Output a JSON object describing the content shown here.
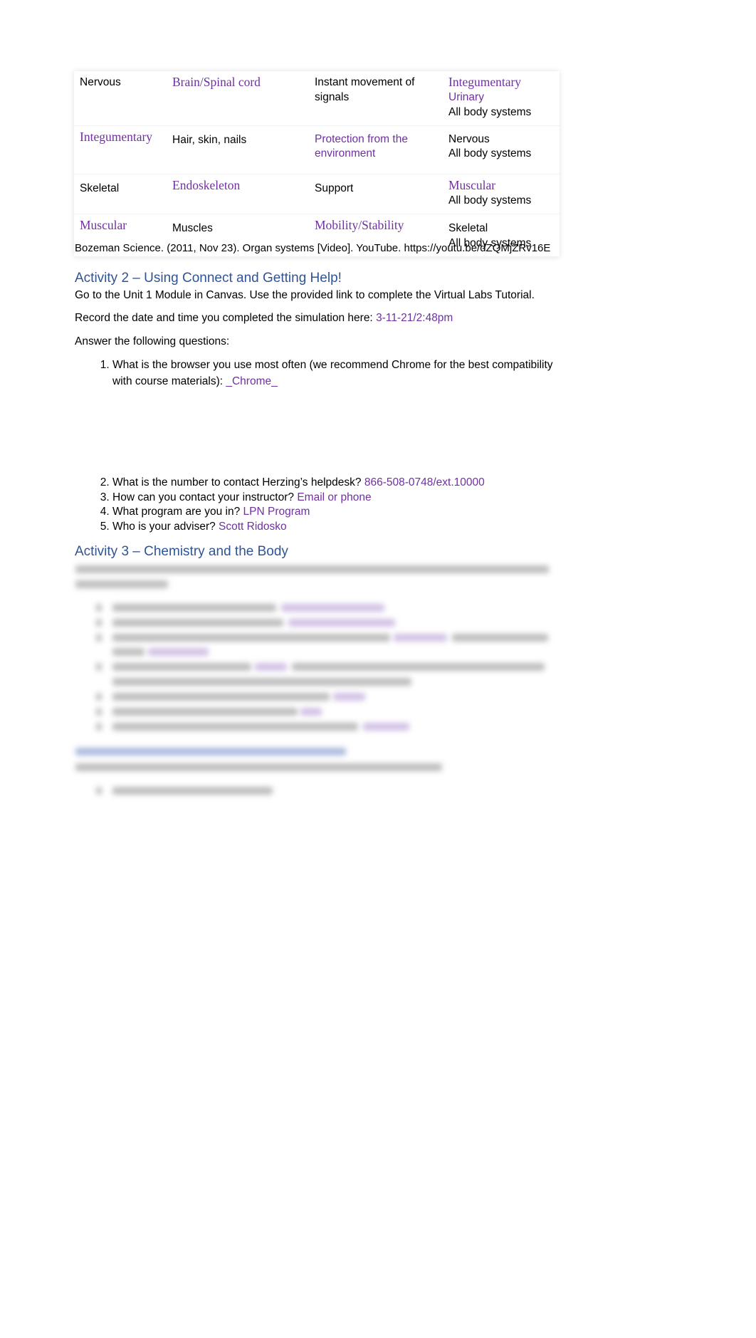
{
  "table": {
    "rows": [
      [
        "Nervous",
        "Brain/Spinal cord",
        "Instant movement of signals",
        [
          "Integumentary",
          "Urinary",
          "All body systems"
        ]
      ],
      [
        "Integumentary",
        "Hair, skin, nails",
        "Protection from the environment",
        [
          "Nervous",
          "All body systems"
        ]
      ],
      [
        "Skeletal",
        "Endoskeleton",
        "Support",
        [
          "Muscular",
          "All body systems"
        ]
      ],
      [
        "Muscular",
        "Muscles",
        "Mobility/Stability",
        [
          "Skeletal",
          "All body systems"
        ]
      ]
    ]
  },
  "citation": "Bozeman Science. (2011, Nov 23). Organ systems [Video]. YouTube. https://youtu.be/dZQMjZRv16E",
  "activity2": {
    "heading": "Activity 2 – Using Connect and Getting Help!",
    "intro": "Go to the Unit 1 Module in Canvas.  Use the provided link to complete the Virtual Labs Tutorial.",
    "record_label": "Record the date and time you completed the simulation here: ",
    "record_value": "3-11-21/2:48pm",
    "answer_prompt": "Answer the following questions:",
    "questions": [
      {
        "q": "What is the browser you use most often (we recommend Chrome for the best compatibility with course materials): ",
        "a": "_Chrome_"
      },
      {
        "q": "What is the number to contact Herzing’s helpdesk? ",
        "a": "866-508-0748/ext.10000"
      },
      {
        "q": "How can you contact your instructor? ",
        "a": "Email or phone"
      },
      {
        "q": "What program are you in? ",
        "a": "LPN Program"
      },
      {
        "q": "Who is your adviser? ",
        "a": "Scott Ridosko"
      }
    ]
  },
  "activity3": {
    "heading": "Activity 3 – Chemistry and the Body"
  },
  "colors": {
    "answer": "#7030a0",
    "heading": "#2f5496"
  }
}
